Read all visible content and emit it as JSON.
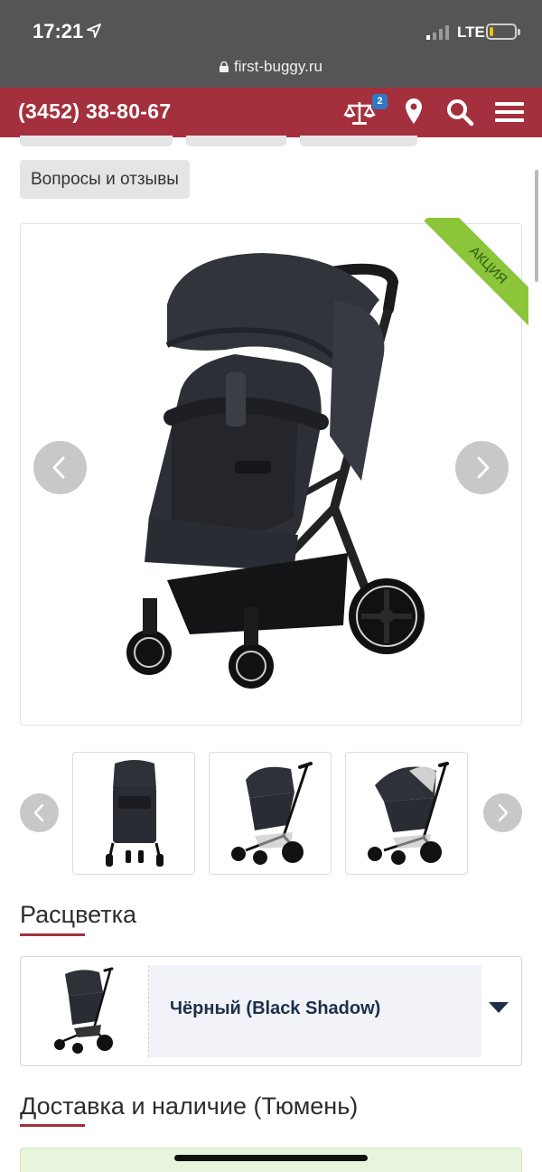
{
  "status_bar": {
    "time": "17:21",
    "network": "LTE",
    "url": "first-buggy.ru",
    "battery_level": 0.15
  },
  "header": {
    "phone": "(3452) 38-80-67",
    "compare_count": "2",
    "brand_color": "#a4303d",
    "icons": [
      "scales-icon",
      "location-pin-icon",
      "search-icon",
      "menu-icon"
    ]
  },
  "tabs": {
    "questions_label": "Вопросы и отзывы"
  },
  "gallery": {
    "badge_label": "АКЦИЯ",
    "badge_color": "#8cc43a",
    "thumbnail_count": 3
  },
  "color_section": {
    "title": "Расцветка",
    "selected_value": "Чёрный (Black Shadow)"
  },
  "delivery_section": {
    "title": "Доставка и наличие (Тюмень)"
  }
}
